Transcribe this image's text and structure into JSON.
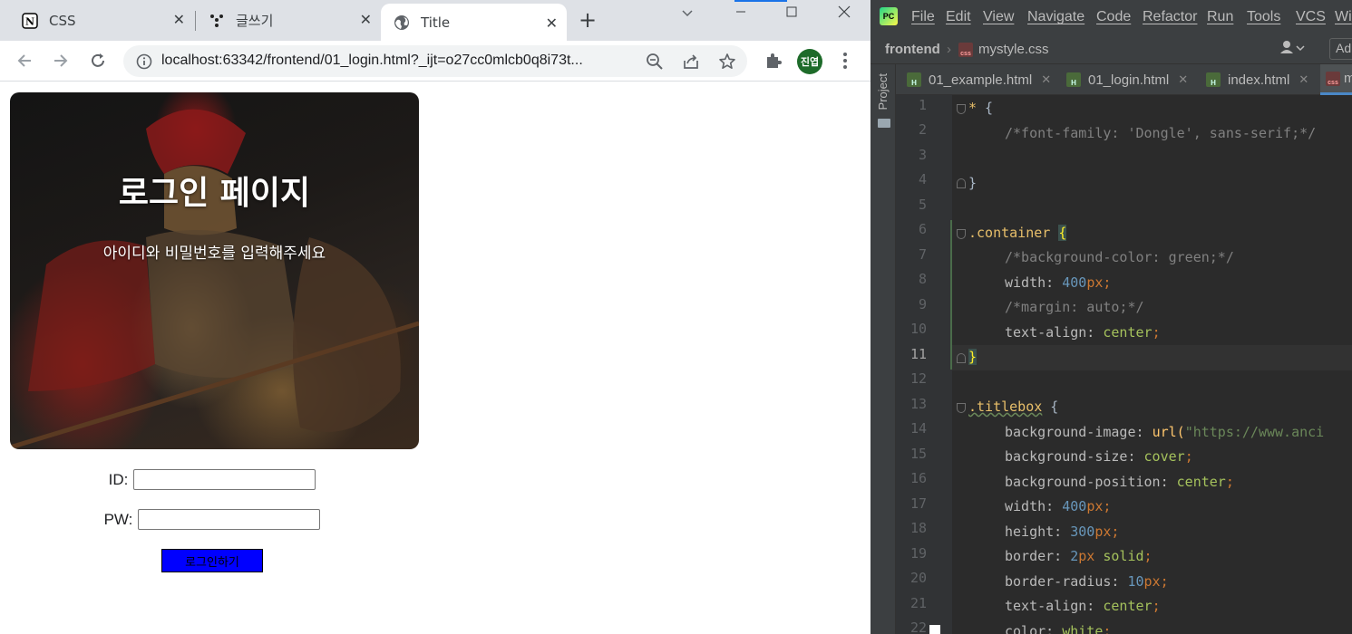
{
  "browser": {
    "tabs": [
      {
        "title": "CSS",
        "icon": "notion-icon"
      },
      {
        "title": "글쓰기",
        "icon": "dots-icon"
      },
      {
        "title": "Title",
        "icon": "globe-icon"
      }
    ],
    "url": "localhost:63342/frontend/01_login.html?_ijt=o27cc0mlcb0q8i73t...",
    "avatar_text": "진엽"
  },
  "page": {
    "title": "로그인 페이지",
    "subtitle": "아이디와 비밀번호를 입력해주세요",
    "id_label": "ID:",
    "pw_label": "PW:",
    "login_button": "로그인하기"
  },
  "ide": {
    "menu": [
      "File",
      "Edit",
      "View",
      "Navigate",
      "Code",
      "Refactor",
      "Run",
      "Tools",
      "VCS",
      "Wi"
    ],
    "breadcrumb_project": "frontend",
    "breadcrumb_file": "mystyle.css",
    "add_config": "Ad",
    "side_label": "Project",
    "tabs": [
      "01_example.html",
      "01_login.html",
      "index.html",
      "m"
    ],
    "line_numbers": [
      "1",
      "2",
      "3",
      "4",
      "5",
      "6",
      "7",
      "8",
      "9",
      "10",
      "11",
      "12",
      "13",
      "14",
      "15",
      "16",
      "17",
      "18",
      "19",
      "20",
      "21",
      "22"
    ],
    "current_line": "11",
    "code": {
      "l1_sel": "*",
      "l1_brace": " {",
      "l2_comment": "/*font-family: 'Dongle', sans-serif;*/",
      "l4_brace": "}",
      "l6_sel": ".container",
      "l6_brace": "{",
      "l7_comment": "/*background-color: green;*/",
      "l8_prop": "width: ",
      "l8_num": "400",
      "l8_unit": "px",
      "l9_comment": "/*margin: auto;*/",
      "l10_prop": "text-align: ",
      "l10_val": "center",
      "l11_brace": "}",
      "l13_sel": ".titlebox",
      "l13_brace": " {",
      "l14_prop": "background-image: ",
      "l14_fn": "url(",
      "l14_str": "\"https://www.anci",
      "l15_prop": "background-size: ",
      "l15_val": "cover",
      "l16_prop": "background-position: ",
      "l16_val": "center",
      "l17_prop": "width: ",
      "l17_num": "400",
      "l17_unit": "px",
      "l18_prop": "height: ",
      "l18_num": "300",
      "l18_unit": "px",
      "l19_prop": "border: ",
      "l19_num": "2",
      "l19_unit": "px ",
      "l19_val": "solid",
      "l20_prop": "border-radius: ",
      "l20_num": "10",
      "l20_unit": "px",
      "l21_prop": "text-align: ",
      "l21_val": "center",
      "l22_prop": "color: ",
      "l22_val": "white",
      "semi": ";"
    }
  },
  "colors": {
    "login_button_bg": "#0000ff",
    "avatar_bg": "#1e6b2a",
    "ide_bg": "#2b2b2b",
    "ide_panel": "#3c3f41"
  }
}
